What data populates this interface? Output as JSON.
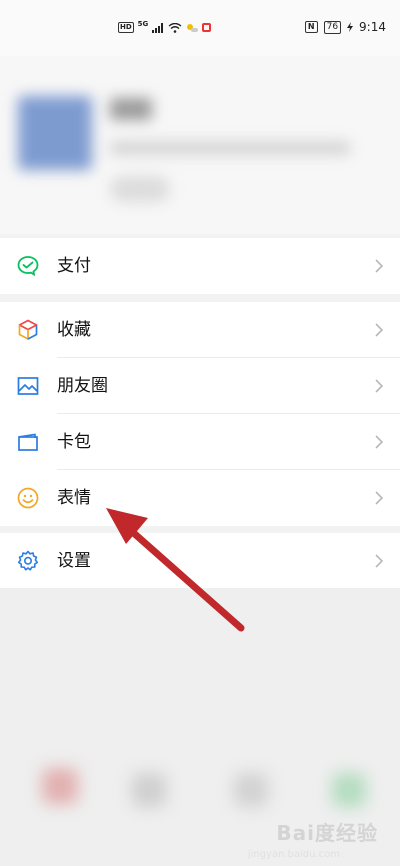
{
  "status_bar": {
    "hd": "HD",
    "net": "5G",
    "battery": "76",
    "time": "9:14",
    "nfc": "N"
  },
  "menu": {
    "pay": {
      "label": "支付",
      "icon": "wechat-pay-icon"
    },
    "favorites": {
      "label": "收藏",
      "icon": "favorites-cube-icon"
    },
    "moments": {
      "label": "朋友圈",
      "icon": "moments-picture-icon"
    },
    "cards": {
      "label": "卡包",
      "icon": "card-wallet-icon"
    },
    "stickers": {
      "label": "表情",
      "icon": "sticker-smile-icon"
    },
    "settings": {
      "label": "设置",
      "icon": "gear-icon"
    }
  },
  "watermark": {
    "text": "Bai度经验",
    "sub": "jingyan.baidu.com"
  },
  "colors": {
    "pay_green": "#07c160",
    "accent_blue": "#2a7de1",
    "sticker_yellow": "#f5a623",
    "annotation_red": "#c0282b"
  }
}
